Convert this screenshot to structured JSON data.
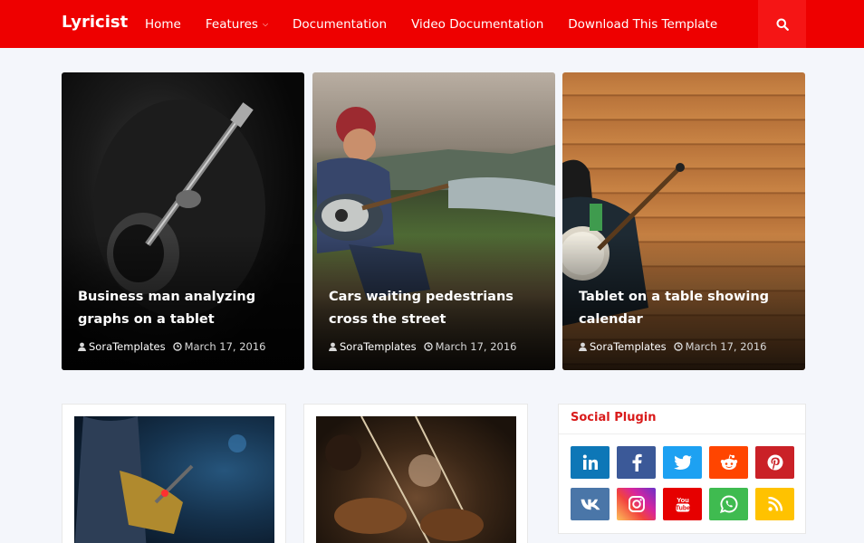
{
  "header": {
    "logo": "Lyricist",
    "nav": [
      {
        "label": "Home"
      },
      {
        "label": "Features",
        "has_dropdown": true
      },
      {
        "label": "Documentation"
      },
      {
        "label": "Video Documentation"
      },
      {
        "label": "Download This Template"
      }
    ],
    "search_icon": "search-icon",
    "accent_color": "#ee0000"
  },
  "featured": [
    {
      "title": "Business man analyzing graphs on a tablet",
      "author": "SoraTemplates",
      "date": "March 17, 2016"
    },
    {
      "title": "Cars waiting pedestrians cross the street",
      "author": "SoraTemplates",
      "date": "March 17, 2016"
    },
    {
      "title": "Tablet on a table showing calendar",
      "author": "SoraTemplates",
      "date": "March 17, 2016"
    }
  ],
  "posts": [
    {
      "image": "guitarist-on-stage"
    },
    {
      "image": "violin-orchestra"
    }
  ],
  "social_widget": {
    "title": "Social Plugin",
    "buttons": [
      {
        "name": "linkedin",
        "color": "#0d77b7"
      },
      {
        "name": "facebook",
        "color": "#3b5998"
      },
      {
        "name": "twitter",
        "color": "#1da1f2"
      },
      {
        "name": "reddit",
        "color": "#ff4500"
      },
      {
        "name": "pinterest",
        "color": "#ca2127"
      },
      {
        "name": "vk",
        "color": "#4a76a8"
      },
      {
        "name": "instagram",
        "color": "#d6249f"
      },
      {
        "name": "youtube",
        "color": "#e60000"
      },
      {
        "name": "whatsapp",
        "color": "#3fbb50"
      },
      {
        "name": "rss",
        "color": "#ffc200"
      }
    ]
  }
}
